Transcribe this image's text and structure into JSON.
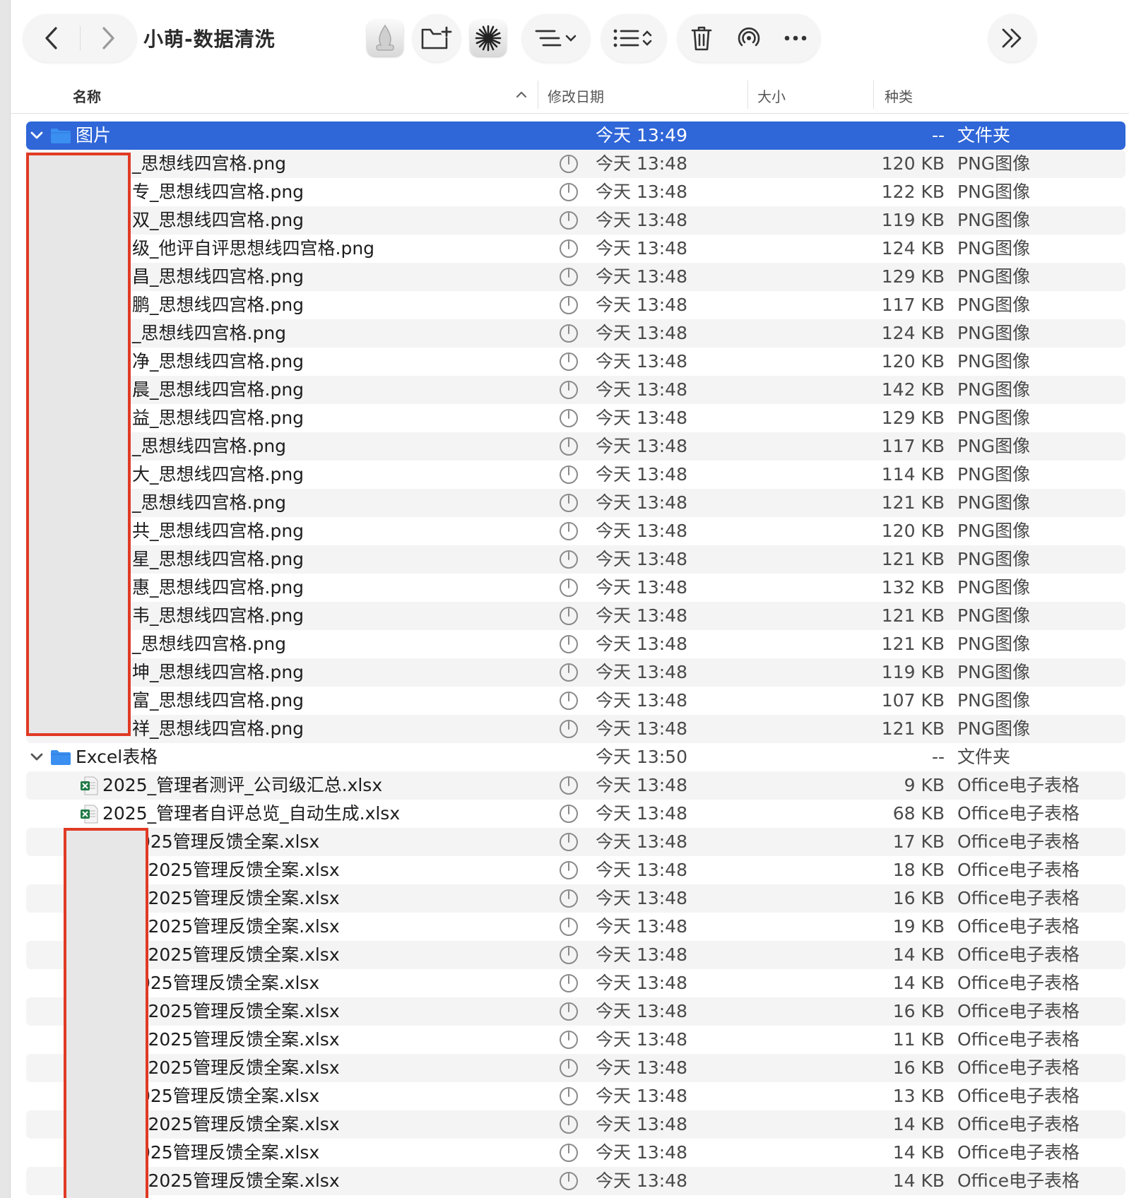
{
  "toolbar": {
    "title": "小萌-数据清洗",
    "back_icon": "chevron-left-icon",
    "forward_icon": "chevron-right-icon",
    "more_icon": "ellipsis-icon",
    "overflow_icon": "double-chevron-right-icon"
  },
  "columns": {
    "name": "名称",
    "date": "修改日期",
    "size": "大小",
    "kind": "种类"
  },
  "colors": {
    "selection": "#2f66d8",
    "folder": "#3a8ff0",
    "redaction_border": "#e03a24"
  },
  "folders": [
    {
      "name": "图片",
      "date": "今天 13:49",
      "size": "--",
      "kind": "文件夹",
      "selected": true,
      "files": [
        {
          "name": "_思想线四宫格.png",
          "date": "今天 13:48",
          "size": "120 KB",
          "kind": "PNG图像"
        },
        {
          "name": "专_思想线四宫格.png",
          "date": "今天 13:48",
          "size": "122 KB",
          "kind": "PNG图像"
        },
        {
          "name": "双_思想线四宫格.png",
          "date": "今天 13:48",
          "size": "119 KB",
          "kind": "PNG图像"
        },
        {
          "name": "级_他评自评思想线四宫格.png",
          "date": "今天 13:48",
          "size": "124 KB",
          "kind": "PNG图像"
        },
        {
          "name": "昌_思想线四宫格.png",
          "date": "今天 13:48",
          "size": "129 KB",
          "kind": "PNG图像"
        },
        {
          "name": "鹏_思想线四宫格.png",
          "date": "今天 13:48",
          "size": "117 KB",
          "kind": "PNG图像"
        },
        {
          "name": "_思想线四宫格.png",
          "date": "今天 13:48",
          "size": "124 KB",
          "kind": "PNG图像"
        },
        {
          "name": "净_思想线四宫格.png",
          "date": "今天 13:48",
          "size": "120 KB",
          "kind": "PNG图像"
        },
        {
          "name": "晨_思想线四宫格.png",
          "date": "今天 13:48",
          "size": "142 KB",
          "kind": "PNG图像"
        },
        {
          "name": "益_思想线四宫格.png",
          "date": "今天 13:48",
          "size": "129 KB",
          "kind": "PNG图像"
        },
        {
          "name": "_思想线四宫格.png",
          "date": "今天 13:48",
          "size": "117 KB",
          "kind": "PNG图像"
        },
        {
          "name": "大_思想线四宫格.png",
          "date": "今天 13:48",
          "size": "114 KB",
          "kind": "PNG图像"
        },
        {
          "name": "_思想线四宫格.png",
          "date": "今天 13:48",
          "size": "121 KB",
          "kind": "PNG图像"
        },
        {
          "name": "共_思想线四宫格.png",
          "date": "今天 13:48",
          "size": "120 KB",
          "kind": "PNG图像"
        },
        {
          "name": "星_思想线四宫格.png",
          "date": "今天 13:48",
          "size": "121 KB",
          "kind": "PNG图像"
        },
        {
          "name": "惠_思想线四宫格.png",
          "date": "今天 13:48",
          "size": "132 KB",
          "kind": "PNG图像"
        },
        {
          "name": "韦_思想线四宫格.png",
          "date": "今天 13:48",
          "size": "121 KB",
          "kind": "PNG图像"
        },
        {
          "name": "_思想线四宫格.png",
          "date": "今天 13:48",
          "size": "121 KB",
          "kind": "PNG图像"
        },
        {
          "name": "坤_思想线四宫格.png",
          "date": "今天 13:48",
          "size": "119 KB",
          "kind": "PNG图像"
        },
        {
          "name": "富_思想线四宫格.png",
          "date": "今天 13:48",
          "size": "107 KB",
          "kind": "PNG图像"
        },
        {
          "name": "祥_思想线四宫格.png",
          "date": "今天 13:48",
          "size": "121 KB",
          "kind": "PNG图像"
        }
      ]
    },
    {
      "name": "Excel表格",
      "date": "今天 13:50",
      "size": "--",
      "kind": "文件夹",
      "selected": false,
      "files": [
        {
          "name": "2025_管理者测评_公司级汇总.xlsx",
          "date": "今天 13:48",
          "size": "9 KB",
          "kind": "Office电子表格"
        },
        {
          "name": "2025_管理者自评总览_自动生成.xlsx",
          "date": "今天 13:48",
          "size": "68 KB",
          "kind": "Office电子表格"
        },
        {
          "name": "025管理反馈全案.xlsx",
          "date": "今天 13:48",
          "size": "17 KB",
          "kind": "Office电子表格"
        },
        {
          "name": "_2025管理反馈全案.xlsx",
          "date": "今天 13:48",
          "size": "18 KB",
          "kind": "Office电子表格"
        },
        {
          "name": "_2025管理反馈全案.xlsx",
          "date": "今天 13:48",
          "size": "16 KB",
          "kind": "Office电子表格"
        },
        {
          "name": "_2025管理反馈全案.xlsx",
          "date": "今天 13:48",
          "size": "19 KB",
          "kind": "Office电子表格"
        },
        {
          "name": "_2025管理反馈全案.xlsx",
          "date": "今天 13:48",
          "size": "14 KB",
          "kind": "Office电子表格"
        },
        {
          "name": "025管理反馈全案.xlsx",
          "date": "今天 13:48",
          "size": "14 KB",
          "kind": "Office电子表格"
        },
        {
          "name": "_2025管理反馈全案.xlsx",
          "date": "今天 13:48",
          "size": "16 KB",
          "kind": "Office电子表格"
        },
        {
          "name": "_2025管理反馈全案.xlsx",
          "date": "今天 13:48",
          "size": "11 KB",
          "kind": "Office电子表格"
        },
        {
          "name": "_2025管理反馈全案.xlsx",
          "date": "今天 13:48",
          "size": "16 KB",
          "kind": "Office电子表格"
        },
        {
          "name": "025管理反馈全案.xlsx",
          "date": "今天 13:48",
          "size": "13 KB",
          "kind": "Office电子表格"
        },
        {
          "name": "_2025管理反馈全案.xlsx",
          "date": "今天 13:48",
          "size": "14 KB",
          "kind": "Office电子表格"
        },
        {
          "name": "025管理反馈全案.xlsx",
          "date": "今天 13:48",
          "size": "14 KB",
          "kind": "Office电子表格"
        },
        {
          "name": "_2025管理反馈全案.xlsx",
          "date": "今天 13:48",
          "size": "14 KB",
          "kind": "Office电子表格"
        }
      ]
    }
  ]
}
